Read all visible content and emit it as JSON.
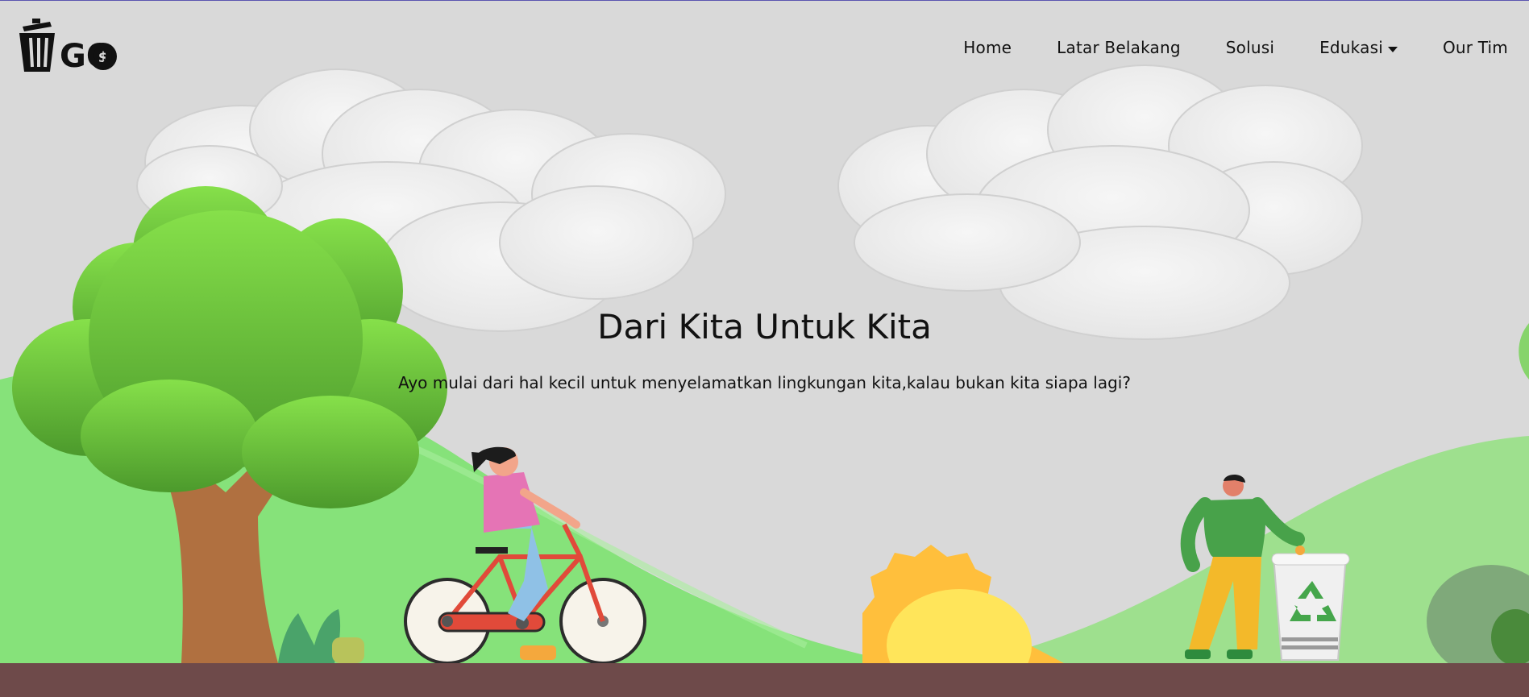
{
  "colors": {
    "sky": "#d9d9d9",
    "ground": "#6e4a4a",
    "hill": "#86e27a",
    "tree_trunk": "#b07040",
    "tree_leaves": "#5fb83e",
    "sun": "#ffc23d"
  },
  "header": {
    "logo_text": "GO",
    "nav": [
      {
        "label": "Home"
      },
      {
        "label": "Latar Belakang"
      },
      {
        "label": "Solusi"
      },
      {
        "label": "Edukasi",
        "has_dropdown": true
      },
      {
        "label": "Our Tim"
      }
    ]
  },
  "hero": {
    "title": "Dari Kita Untuk Kita",
    "subtitle": "Ayo mulai dari hal kecil untuk menyelamatkan lingkungan kita,kalau bukan kita siapa lagi?"
  },
  "icons": {
    "logo": "trash-can-logo-icon",
    "dropdown": "caret-down-icon",
    "recycle": "recycle-icon"
  }
}
